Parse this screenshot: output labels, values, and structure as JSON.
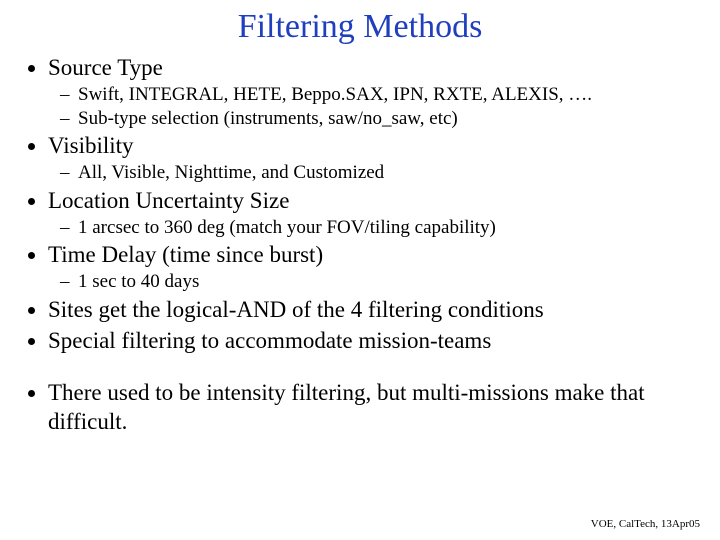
{
  "title": "Filtering  Methods",
  "bullets": {
    "b1": "Source Type",
    "b1_s1": "Swift,  INTEGRAL,  HETE,  Beppo.SAX,  IPN,  RXTE,  ALEXIS, ….",
    "b1_s2": "Sub-type selection  (instruments,  saw/no_saw,  etc)",
    "b2": "Visibility",
    "b2_s1": "All,  Visible,  Nighttime,  and Customized",
    "b3": "Location Uncertainty Size",
    "b3_s1": "1 arcsec  to  360 deg   (match your FOV/tiling capability)",
    "b4": "Time Delay  (time since burst)",
    "b4_s1": "1 sec  to  40 days",
    "b5": "Sites get the logical-AND of the 4 filtering conditions",
    "b6": "Special filtering to accommodate mission-teams",
    "b7": "There used to be intensity filtering, but multi-missions make that difficult."
  },
  "footer": "VOE, CalTech, 13Apr05"
}
